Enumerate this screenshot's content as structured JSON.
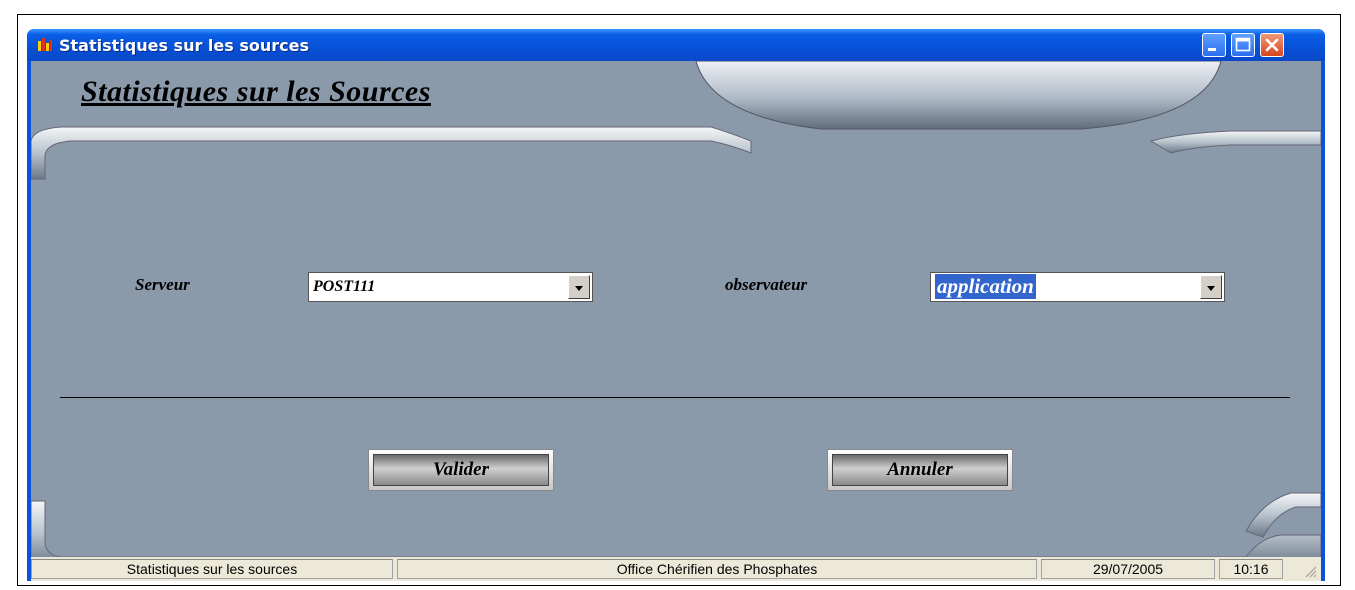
{
  "window": {
    "title": "Statistiques sur les sources"
  },
  "form": {
    "heading": "Statistiques sur les Sources",
    "serveur_label": "Serveur",
    "serveur_value": "POST111",
    "observateur_label": "observateur",
    "observateur_value": "application"
  },
  "buttons": {
    "valider": "Valider",
    "annuler": "Annuler"
  },
  "statusbar": {
    "form_name": "Statistiques sur les sources",
    "company": "Office Chérifien des Phosphates",
    "date": "29/07/2005",
    "time": "10:16"
  },
  "colors": {
    "titlebar": "#0a52dc",
    "client_bg": "#8a9aaa",
    "selection": "#3366cc"
  },
  "icons": {
    "app": "bar-chart-icon",
    "minimize": "minimize-icon",
    "maximize": "maximize-icon",
    "close": "close-icon",
    "dropdown": "chevron-down-icon",
    "grip": "resize-grip-icon"
  }
}
